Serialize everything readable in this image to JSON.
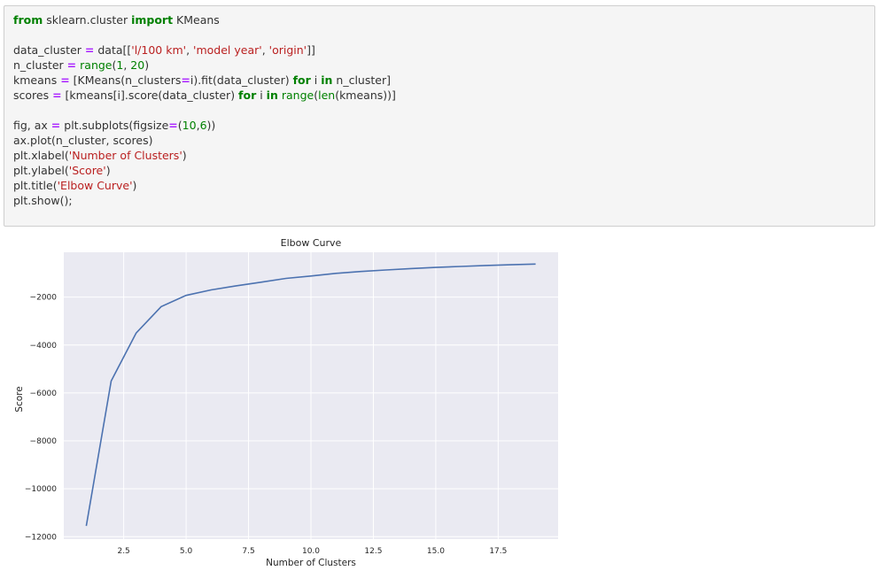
{
  "code": {
    "lines": [
      [
        {
          "t": "from",
          "c": "kw"
        },
        {
          "t": " sklearn.cluster ",
          "c": ""
        },
        {
          "t": "import",
          "c": "kw"
        },
        {
          "t": " KMeans",
          "c": ""
        }
      ],
      [],
      [
        {
          "t": "data_cluster ",
          "c": ""
        },
        {
          "t": "=",
          "c": "op"
        },
        {
          "t": " data[[",
          "c": ""
        },
        {
          "t": "'l/100 km'",
          "c": "str"
        },
        {
          "t": ", ",
          "c": ""
        },
        {
          "t": "'model year'",
          "c": "str"
        },
        {
          "t": ", ",
          "c": ""
        },
        {
          "t": "'origin'",
          "c": "str"
        },
        {
          "t": "]]",
          "c": ""
        }
      ],
      [
        {
          "t": "n_cluster ",
          "c": ""
        },
        {
          "t": "=",
          "c": "op"
        },
        {
          "t": " ",
          "c": ""
        },
        {
          "t": "range",
          "c": "bi"
        },
        {
          "t": "(",
          "c": ""
        },
        {
          "t": "1",
          "c": "num"
        },
        {
          "t": ", ",
          "c": ""
        },
        {
          "t": "20",
          "c": "num"
        },
        {
          "t": ")",
          "c": ""
        }
      ],
      [
        {
          "t": "kmeans ",
          "c": ""
        },
        {
          "t": "=",
          "c": "op"
        },
        {
          "t": " [KMeans(n_clusters",
          "c": ""
        },
        {
          "t": "=",
          "c": "op"
        },
        {
          "t": "i).fit(data_cluster) ",
          "c": ""
        },
        {
          "t": "for",
          "c": "kw"
        },
        {
          "t": " i ",
          "c": ""
        },
        {
          "t": "in",
          "c": "kw"
        },
        {
          "t": " n_cluster]",
          "c": ""
        }
      ],
      [
        {
          "t": "scores ",
          "c": ""
        },
        {
          "t": "=",
          "c": "op"
        },
        {
          "t": " [kmeans[i].score(data_cluster) ",
          "c": ""
        },
        {
          "t": "for",
          "c": "kw"
        },
        {
          "t": " i ",
          "c": ""
        },
        {
          "t": "in",
          "c": "kw"
        },
        {
          "t": " ",
          "c": ""
        },
        {
          "t": "range",
          "c": "bi"
        },
        {
          "t": "(",
          "c": ""
        },
        {
          "t": "len",
          "c": "bi"
        },
        {
          "t": "(kmeans))]",
          "c": ""
        }
      ],
      [],
      [
        {
          "t": "fig, ax ",
          "c": ""
        },
        {
          "t": "=",
          "c": "op"
        },
        {
          "t": " plt.subplots(figsize",
          "c": ""
        },
        {
          "t": "=",
          "c": "op"
        },
        {
          "t": "(",
          "c": ""
        },
        {
          "t": "10",
          "c": "num"
        },
        {
          "t": ",",
          "c": ""
        },
        {
          "t": "6",
          "c": "num"
        },
        {
          "t": "))",
          "c": ""
        }
      ],
      [
        {
          "t": "ax.plot(n_cluster, scores)",
          "c": ""
        }
      ],
      [
        {
          "t": "plt.xlabel(",
          "c": ""
        },
        {
          "t": "'Number of Clusters'",
          "c": "str"
        },
        {
          "t": ")",
          "c": ""
        }
      ],
      [
        {
          "t": "plt.ylabel(",
          "c": ""
        },
        {
          "t": "'Score'",
          "c": "str"
        },
        {
          "t": ")",
          "c": ""
        }
      ],
      [
        {
          "t": "plt.title(",
          "c": ""
        },
        {
          "t": "'Elbow Curve'",
          "c": "str"
        },
        {
          "t": ")",
          "c": ""
        }
      ],
      [
        {
          "t": "plt.show();",
          "c": ""
        }
      ]
    ]
  },
  "colors": {
    "plot_bg": "#eaeaf2",
    "grid": "#ffffff",
    "line": "#4c72b0",
    "text": "#262626"
  },
  "chart_data": {
    "type": "line",
    "title": "Elbow Curve",
    "xlabel": "Number of Clusters",
    "ylabel": "Score",
    "x": [
      1,
      2,
      3,
      4,
      5,
      6,
      7,
      8,
      9,
      10,
      11,
      12,
      13,
      14,
      15,
      16,
      17,
      18,
      19
    ],
    "series": [
      {
        "values": [
          -11550,
          -5500,
          -3500,
          -2400,
          -1930,
          -1700,
          -1530,
          -1380,
          -1220,
          -1120,
          -1010,
          -930,
          -870,
          -810,
          -760,
          -720,
          -680,
          -650,
          -620
        ]
      }
    ],
    "xlim": [
      0.1,
      19.9
    ],
    "ylim": [
      -12100,
      -130
    ],
    "xticks": [
      2.5,
      5.0,
      7.5,
      10.0,
      12.5,
      15.0,
      17.5
    ],
    "xtick_labels": [
      "2.5",
      "5.0",
      "7.5",
      "10.0",
      "12.5",
      "15.0",
      "17.5"
    ],
    "yticks": [
      -2000,
      -4000,
      -6000,
      -8000,
      -10000,
      -12000
    ],
    "ytick_labels": [
      "−2000",
      "−4000",
      "−6000",
      "−8000",
      "−10000",
      "−12000"
    ],
    "grid": true,
    "style": "seaborn-darkgrid"
  }
}
